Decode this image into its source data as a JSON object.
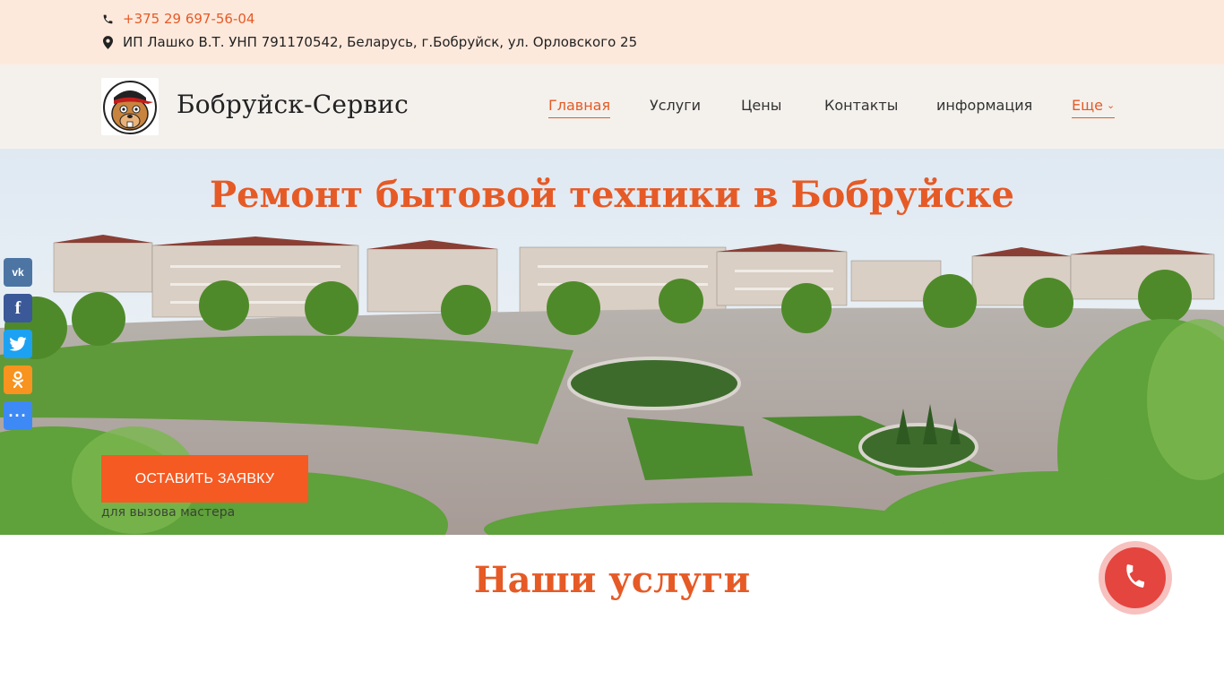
{
  "contacts": {
    "phone": "+375 29 697-56-04",
    "address": "ИП Лашко В.Т. УНП 791170542, Беларусь, г.Бобруйск, ул. Орловского 25",
    "phone_icon": "phone-icon",
    "address_icon": "map-marker-icon"
  },
  "header": {
    "site_name": "Бобруйск-Сервис",
    "logo_icon": "beaver-logo-icon",
    "nav": [
      {
        "label": "Главная",
        "active": true
      },
      {
        "label": "Услуги"
      },
      {
        "label": "Цены"
      },
      {
        "label": "Контакты"
      },
      {
        "label": "информация"
      },
      {
        "label": "Еще",
        "dropdown": true
      }
    ]
  },
  "hero": {
    "title": "Ремонт бытовой техники в Бобруйске",
    "cta_label": "ОСТАВИТЬ ЗАЯВКУ",
    "cta_sub": "для вызова мастера"
  },
  "social": [
    {
      "name": "vk-icon",
      "glyph": "vk"
    },
    {
      "name": "facebook-icon",
      "glyph": "f"
    },
    {
      "name": "twitter-icon",
      "glyph": "t"
    },
    {
      "name": "odnoklassniki-icon",
      "glyph": "ok"
    },
    {
      "name": "more-share-icon",
      "glyph": "···"
    }
  ],
  "services": {
    "title": "Наши услуги"
  },
  "colors": {
    "accent": "#e65a26",
    "cta": "#f55a22",
    "topbar_bg": "#fde9dc",
    "header_bg": "#f4f1ed",
    "call_button": "#e4453f"
  }
}
